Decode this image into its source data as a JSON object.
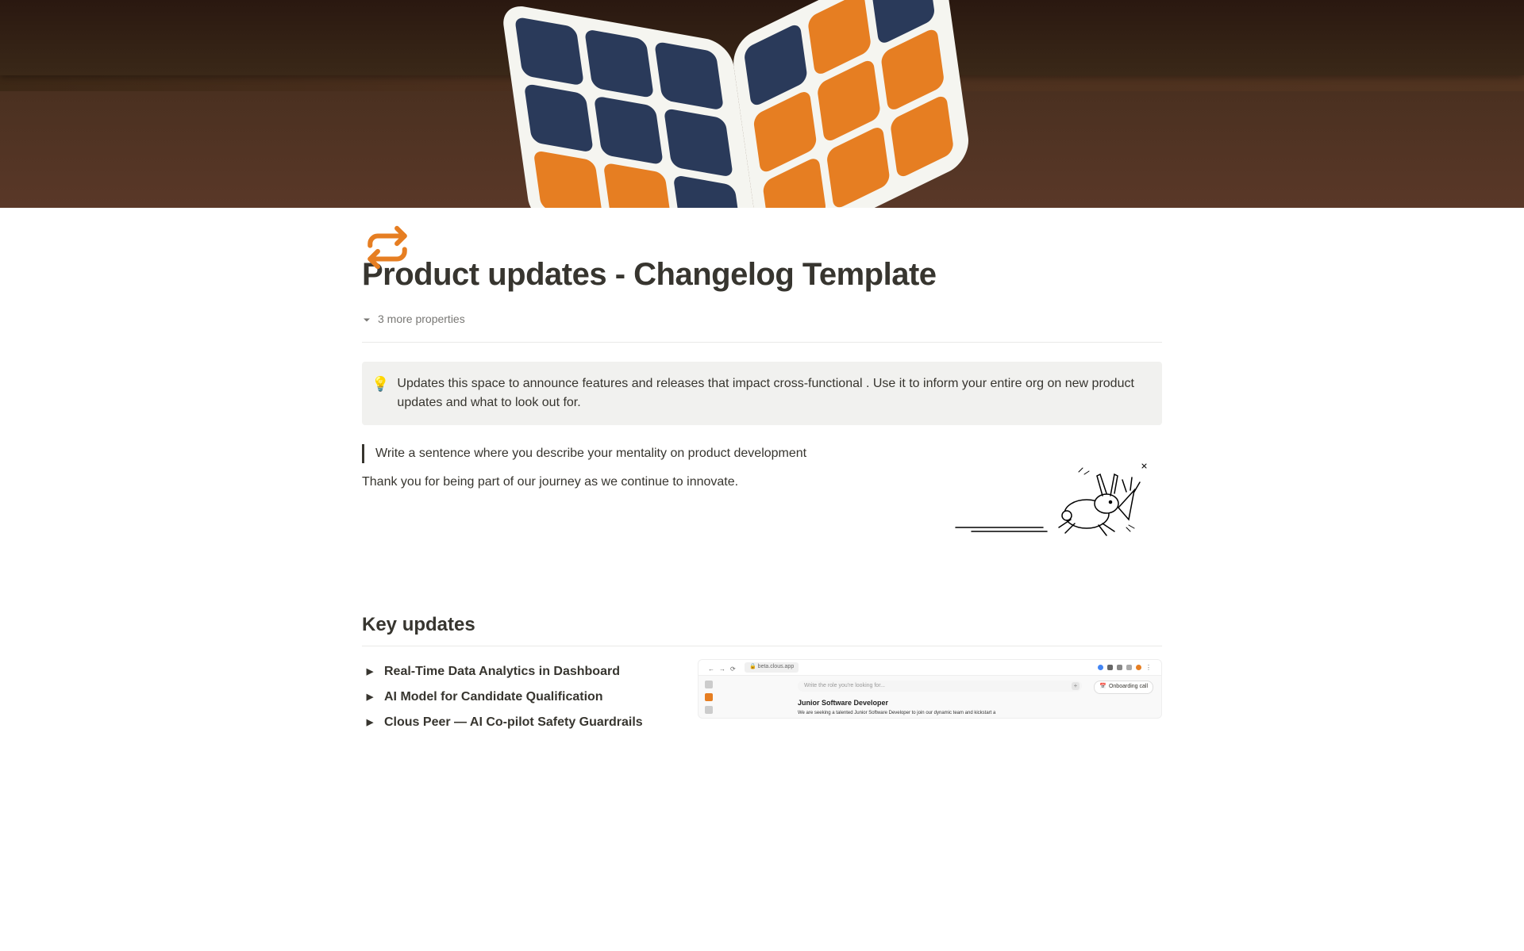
{
  "page": {
    "title": "Product updates - Changelog Template",
    "properties_label": "3 more properties"
  },
  "callout": {
    "icon": "💡",
    "text": "Updates this space to announce features and releases that impact cross-functional . Use it to inform your entire org on new product updates and what to look out for."
  },
  "intro": {
    "quote": "Write a sentence where you describe your mentality on product development",
    "thank_you": "Thank you for being part of our journey as we continue to innovate."
  },
  "sections": {
    "key_updates_heading": "Key updates"
  },
  "updates": [
    {
      "title": "Real-Time Data Analytics in Dashboard"
    },
    {
      "title": "AI Model for Candidate Qualification"
    },
    {
      "title": "Clous Peer — AI Co-pilot Safety Guardrails"
    }
  ],
  "screenshot": {
    "url": "beta.clous.app",
    "search_placeholder": "Write the role you're looking for...",
    "onboarding_button": "Onboarding call",
    "job_title": "Junior Software Developer",
    "job_subtitle": "We are seeking a talented Junior Software Developer to join our dynamic team and kickstart a"
  }
}
